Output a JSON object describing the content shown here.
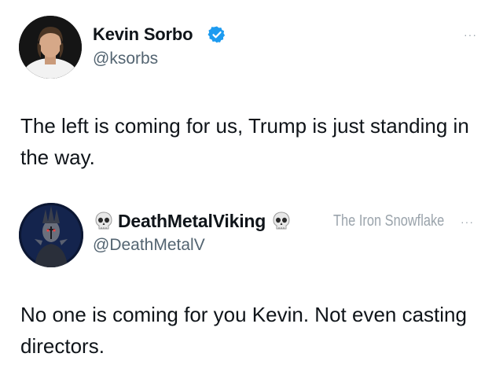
{
  "tweets": [
    {
      "name": "Kevin Sorbo",
      "handle": "@ksorbs",
      "text": "The left is coming for us, Trump is just standing in the way.",
      "verified": true,
      "verified_color": "#1d9bf0"
    },
    {
      "name": "DeathMetalViking",
      "handle": "@DeathMetalV",
      "text": "No one is coming for you Kevin. Not even casting directors.",
      "name_icons": [
        "skull-icon",
        "skull-icon"
      ]
    }
  ],
  "more_label": "···",
  "watermark": "The Iron Snowflake",
  "colors": {
    "text": "#0f1419",
    "handle": "#536471",
    "muted": "#9aa3ab"
  }
}
